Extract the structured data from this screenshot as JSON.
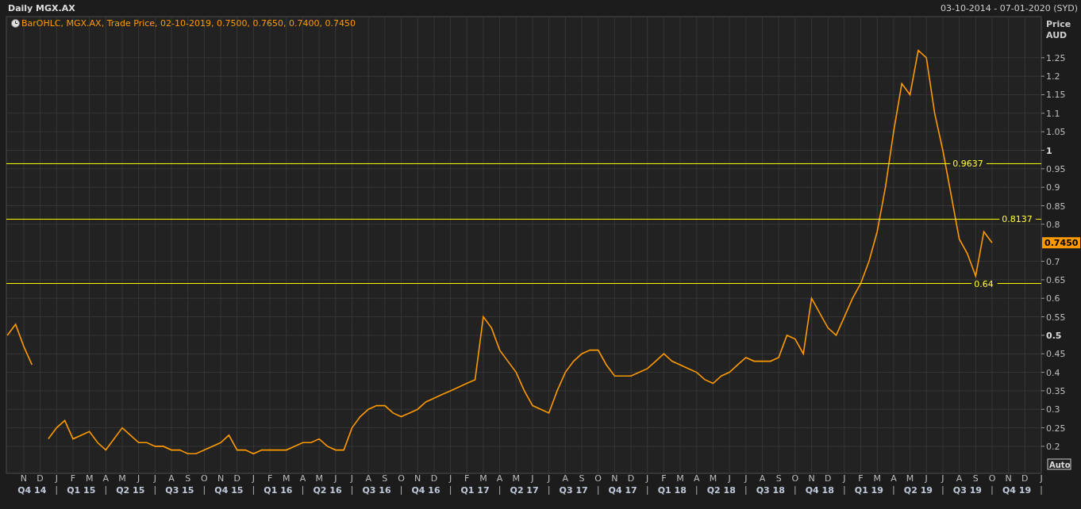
{
  "header": {
    "title": "Daily MGX.AX",
    "date_range": "03-10-2014 - 07-01-2020 (SYD)"
  },
  "chart": {
    "legend": {
      "prefix": "BarOHLC,",
      "suffix": ", Trade Price, 02-10-2019, 0.7500, 0.7650, 0.7400, 0.7450"
    },
    "axis_title": [
      "Price",
      "AUD"
    ],
    "quarters": [
      "Q4 14",
      "Q1 15",
      "Q2 15",
      "Q3 15",
      "Q4 15",
      "Q1 16",
      "Q2 16",
      "Q3 16",
      "Q4 16",
      "Q1 17",
      "Q2 17",
      "Q3 17",
      "Q4 17",
      "Q1 18",
      "Q2 18",
      "Q3 18",
      "Q4 18",
      "Q1 19",
      "Q2 19",
      "Q3 19",
      "Q4 19"
    ],
    "auto_button": "Auto",
    "chart_data": {
      "type": "line",
      "categories": [
        null,
        null,
        "N",
        null,
        "D",
        null,
        "J",
        null,
        "F",
        null,
        "M",
        null,
        "A",
        null,
        "M",
        null,
        "J",
        null,
        "J",
        null,
        "A",
        null,
        "S",
        null,
        "O",
        null,
        "N",
        null,
        "D",
        null,
        "J",
        null,
        "F",
        null,
        "M",
        null,
        "A",
        null,
        "M",
        null,
        "J",
        null,
        "J",
        null,
        "A",
        null,
        "S",
        null,
        "O",
        null,
        "N",
        null,
        "D",
        null,
        "J",
        null,
        "F",
        null,
        "M",
        null,
        "A",
        null,
        "M",
        null,
        "J",
        null,
        "J",
        null,
        "A",
        null,
        "S",
        null,
        "O",
        null,
        "N",
        null,
        "D",
        null,
        "J",
        null,
        "F",
        null,
        "M",
        null,
        "A",
        null,
        "M",
        null,
        "J",
        null,
        "J",
        null,
        "A",
        null,
        "S",
        null,
        "O",
        null,
        "N",
        null,
        "D",
        null,
        "J",
        null,
        "F",
        null,
        "M",
        null,
        "A",
        null,
        "M",
        null,
        "J",
        null,
        "J",
        null,
        "A",
        null,
        "S",
        null,
        "O",
        null,
        "N",
        null,
        "D",
        null,
        "J"
      ],
      "ylim": [
        0.127,
        1.361
      ],
      "series": [
        {
          "name": "MGX.AX",
          "color": "#ff9900",
          "values": [
            0.5,
            0.53,
            0.47,
            0.42,
            null,
            0.22,
            0.25,
            0.27,
            0.22,
            0.23,
            0.24,
            0.21,
            0.19,
            0.22,
            0.25,
            0.23,
            0.21,
            0.21,
            0.2,
            0.2,
            0.19,
            0.19,
            0.18,
            0.18,
            0.19,
            0.2,
            0.21,
            0.23,
            0.19,
            0.19,
            0.18,
            0.19,
            0.19,
            0.19,
            0.19,
            0.2,
            0.21,
            0.21,
            0.22,
            0.2,
            0.19,
            0.19,
            0.25,
            0.28,
            0.3,
            0.31,
            0.31,
            0.29,
            0.28,
            0.29,
            0.3,
            0.32,
            0.33,
            0.34,
            0.35,
            0.36,
            0.37,
            0.38,
            0.55,
            0.52,
            0.46,
            0.43,
            0.4,
            0.35,
            0.31,
            0.3,
            0.29,
            0.35,
            0.4,
            0.43,
            0.45,
            0.46,
            0.46,
            0.42,
            0.39,
            0.39,
            0.39,
            0.4,
            0.41,
            0.43,
            0.45,
            0.43,
            0.42,
            0.41,
            0.4,
            0.38,
            0.37,
            0.39,
            0.4,
            0.42,
            0.44,
            0.43,
            0.43,
            0.43,
            0.44,
            0.5,
            0.49,
            0.45,
            0.6,
            0.56,
            0.52,
            0.5,
            0.55,
            0.6,
            0.64,
            0.7,
            0.78,
            0.9,
            1.05,
            1.18,
            1.15,
            1.27,
            1.25,
            1.1,
            1.0,
            0.88,
            0.76,
            0.72,
            0.66,
            0.78,
            0.75,
            null,
            null,
            null,
            null,
            null,
            null
          ]
        }
      ],
      "yticks": [
        {
          "value": 0.2,
          "label": "0.2"
        },
        {
          "value": 0.25,
          "label": "0.25"
        },
        {
          "value": 0.3,
          "label": "0.3"
        },
        {
          "value": 0.35,
          "label": "0.35"
        },
        {
          "value": 0.4,
          "label": "0.4"
        },
        {
          "value": 0.45,
          "label": "0.45"
        },
        {
          "value": 0.5,
          "label": "0.5"
        },
        {
          "value": 0.55,
          "label": "0.55"
        },
        {
          "value": 0.6,
          "label": "0.6"
        },
        {
          "value": 0.65,
          "label": "0.65"
        },
        {
          "value": 0.7,
          "label": "0.7"
        },
        {
          "value": 0.8,
          "label": "0.8"
        },
        {
          "value": 0.85,
          "label": "0.85"
        },
        {
          "value": 0.9,
          "label": "0.9"
        },
        {
          "value": 0.95,
          "label": "0.95"
        },
        {
          "value": 1,
          "label": "1"
        },
        {
          "value": 1.05,
          "label": "1.05"
        },
        {
          "value": 1.1,
          "label": "1.1"
        },
        {
          "value": 1.15,
          "label": "1.15"
        },
        {
          "value": 1.2,
          "label": "1.2"
        },
        {
          "value": 1.25,
          "label": "1.25"
        }
      ],
      "grid": true,
      "ref_lines": [
        {
          "axis": "y",
          "value": 0.9637,
          "label": "0.9637"
        },
        {
          "axis": "y",
          "value": 0.8137,
          "label": "0.8137"
        },
        {
          "axis": "y",
          "value": 0.64,
          "label": "0.64"
        }
      ]
    },
    "price_tag": "0.7450"
  }
}
